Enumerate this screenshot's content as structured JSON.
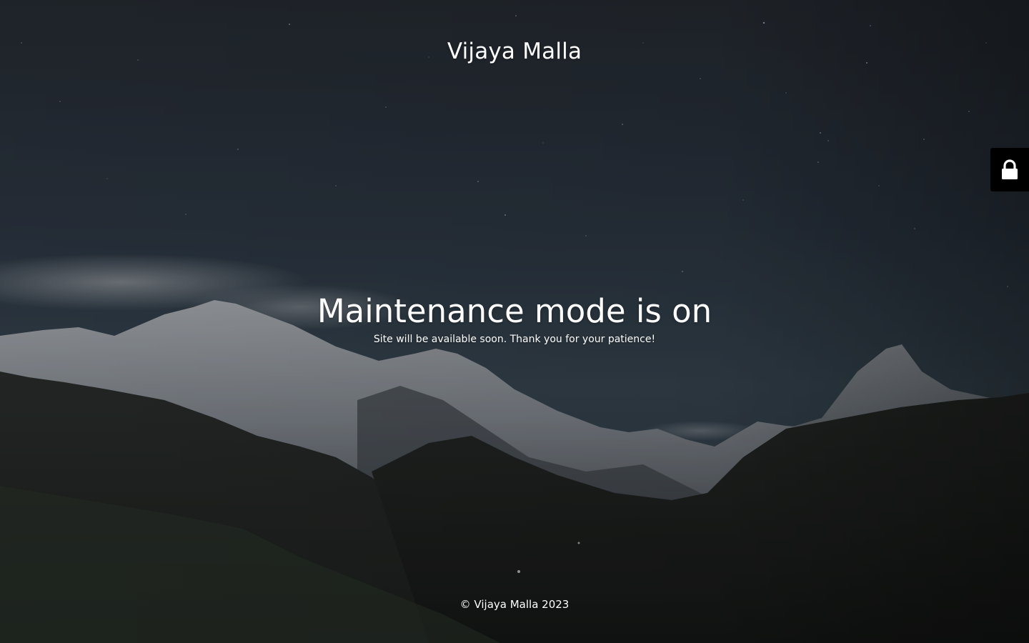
{
  "site": {
    "title": "Vijaya Malla"
  },
  "main": {
    "headline": "Maintenance mode is on",
    "message": "Site will be available soon. Thank you for your patience!"
  },
  "footer": {
    "copyright": "© Vijaya Malla 2023"
  },
  "login_tab": {
    "icon": "lock-icon"
  },
  "colors": {
    "sky_top": "#262b33",
    "sky_mid": "#34414f",
    "text": "#ffffff",
    "login_tab_bg": "#000000"
  }
}
